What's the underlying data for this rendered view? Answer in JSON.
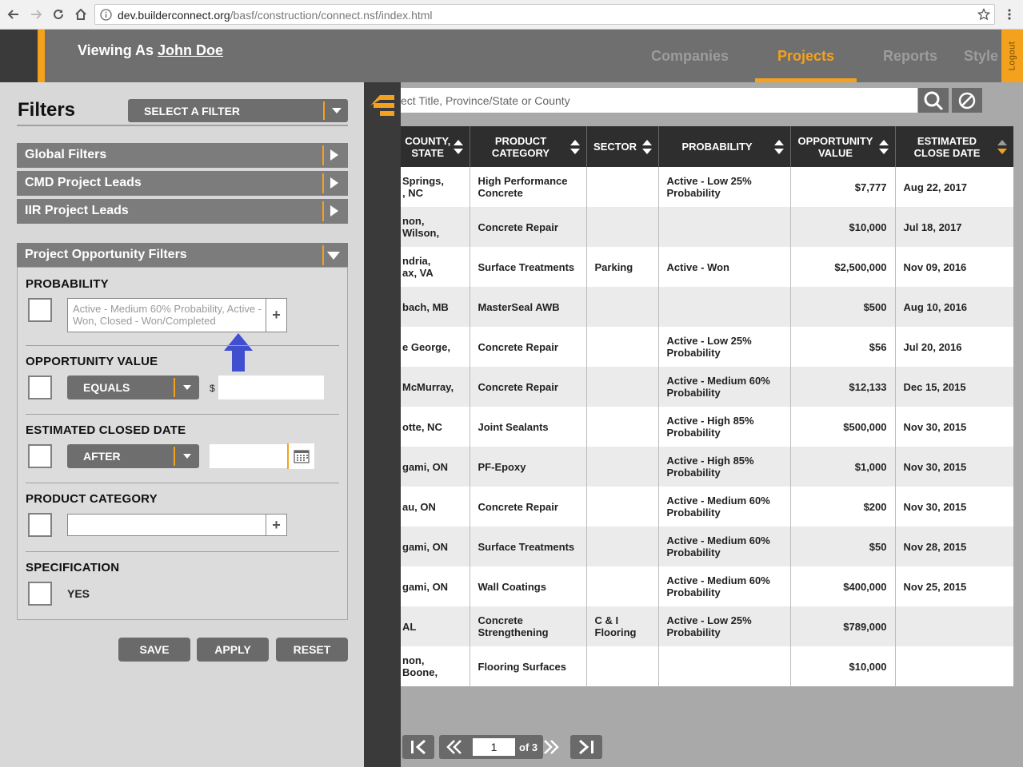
{
  "browser": {
    "url_host": "dev.builderconnect.org",
    "url_path": "/basf/construction/connect.nsf/index.html"
  },
  "header": {
    "viewing_as": "Viewing As",
    "user_name": "John Doe",
    "tabs": [
      {
        "label": "Companies"
      },
      {
        "label": "Projects"
      },
      {
        "label": "Reports"
      },
      {
        "label": "Style"
      }
    ],
    "active_tab": "Projects",
    "logout": "Logout"
  },
  "filters": {
    "title": "Filters",
    "select_filter": "SELECT A FILTER",
    "groups": [
      {
        "label": "Global Filters"
      },
      {
        "label": "CMD Project Leads"
      },
      {
        "label": "IIR Project Leads"
      }
    ],
    "opportunity_group": "Project Opportunity Filters",
    "probability": {
      "label": "PROBABILITY",
      "value": "Active - Medium 60% Probability, Active - Won, Closed - Won/Completed"
    },
    "opportunity_value": {
      "label": "OPPORTUNITY VALUE",
      "operator": "EQUALS",
      "currency": "$",
      "value": ""
    },
    "estimated_closed_date": {
      "label": "ESTIMATED CLOSED DATE",
      "operator": "AFTER",
      "value": ""
    },
    "product_category": {
      "label": "PRODUCT CATEGORY",
      "value": ""
    },
    "specification": {
      "label": "SPECIFICATION",
      "option": "YES"
    },
    "buttons": {
      "save": "SAVE",
      "apply": "APPLY",
      "reset": "RESET"
    }
  },
  "search": {
    "placeholder": "ect Title, Province/State or County"
  },
  "table": {
    "columns": [
      {
        "line1": "COUNTY,",
        "line2": "STATE"
      },
      {
        "line1": "PRODUCT",
        "line2": "CATEGORY"
      },
      {
        "line1": "SECTOR",
        "line2": ""
      },
      {
        "line1": "PROBABILITY",
        "line2": ""
      },
      {
        "line1": "OPPORTUNITY",
        "line2": "VALUE"
      },
      {
        "line1": "ESTIMATED",
        "line2": "CLOSE DATE"
      }
    ],
    "sorted_column": 5,
    "rows": [
      {
        "county": "Springs,",
        "county2": ", NC",
        "product": "High Performance",
        "product2": "Concrete",
        "sector": "",
        "sector2": "",
        "prob": "Active - Low 25%",
        "prob2": "Probability",
        "value": "$7,777",
        "date": "Aug 22, 2017"
      },
      {
        "county": "non, Wilson,",
        "county2": "",
        "product": "Concrete Repair",
        "product2": "",
        "sector": "",
        "sector2": "",
        "prob": "",
        "prob2": "",
        "value": "$10,000",
        "date": "Jul 18, 2017"
      },
      {
        "county": "ndria,",
        "county2": "ax, VA",
        "product": "Surface Treatments",
        "product2": "",
        "sector": "Parking",
        "sector2": "",
        "prob": "Active - Won",
        "prob2": "",
        "value": "$2,500,000",
        "date": "Nov 09, 2016"
      },
      {
        "county": "bach, MB",
        "county2": "",
        "product": "MasterSeal AWB",
        "product2": "",
        "sector": "",
        "sector2": "",
        "prob": "",
        "prob2": "",
        "value": "$500",
        "date": "Aug 10, 2016"
      },
      {
        "county": "e George,",
        "county2": "",
        "product": "Concrete Repair",
        "product2": "",
        "sector": "",
        "sector2": "",
        "prob": "Active - Low 25%",
        "prob2": "Probability",
        "value": "$56",
        "date": "Jul 20, 2016"
      },
      {
        "county": "McMurray,",
        "county2": "",
        "product": "Concrete Repair",
        "product2": "",
        "sector": "",
        "sector2": "",
        "prob": "Active - Medium 60%",
        "prob2": "Probability",
        "value": "$12,133",
        "date": "Dec 15, 2015"
      },
      {
        "county": "otte, NC",
        "county2": "",
        "product": "Joint Sealants",
        "product2": "",
        "sector": "",
        "sector2": "",
        "prob": "Active - High 85%",
        "prob2": "Probability",
        "value": "$500,000",
        "date": "Nov 30, 2015"
      },
      {
        "county": "gami, ON",
        "county2": "",
        "product": "PF-Epoxy",
        "product2": "",
        "sector": "",
        "sector2": "",
        "prob": "Active - High 85%",
        "prob2": "Probability",
        "value": "$1,000",
        "date": "Nov 30, 2015"
      },
      {
        "county": "au, ON",
        "county2": "",
        "product": "Concrete Repair",
        "product2": "",
        "sector": "",
        "sector2": "",
        "prob": "Active - Medium 60%",
        "prob2": "Probability",
        "value": "$200",
        "date": "Nov 30, 2015"
      },
      {
        "county": "gami, ON",
        "county2": "",
        "product": "Surface Treatments",
        "product2": "",
        "sector": "",
        "sector2": "",
        "prob": "Active - Medium 60%",
        "prob2": "Probability",
        "value": "$50",
        "date": "Nov 28, 2015"
      },
      {
        "county": "gami, ON",
        "county2": "",
        "product": "Wall Coatings",
        "product2": "",
        "sector": "",
        "sector2": "",
        "prob": "Active - Medium 60%",
        "prob2": "Probability",
        "value": "$400,000",
        "date": "Nov 25, 2015"
      },
      {
        "county": "AL",
        "county2": "",
        "product": "Concrete",
        "product2": "Strengthening",
        "sector": "C & I",
        "sector2": "Flooring",
        "prob": "Active - Low 25%",
        "prob2": "Probability",
        "value": "$789,000",
        "date": ""
      },
      {
        "county": "non, Boone,",
        "county2": "",
        "product": "Flooring Surfaces",
        "product2": "",
        "sector": "",
        "sector2": "",
        "prob": "",
        "prob2": "",
        "value": "$10,000",
        "date": ""
      }
    ]
  },
  "pager": {
    "current_page": "1",
    "of_label": "of 3"
  },
  "colors": {
    "accent": "#f4a21d",
    "header_bg": "#6f6f6f",
    "annotation_arrow": "#3f4fd0"
  }
}
